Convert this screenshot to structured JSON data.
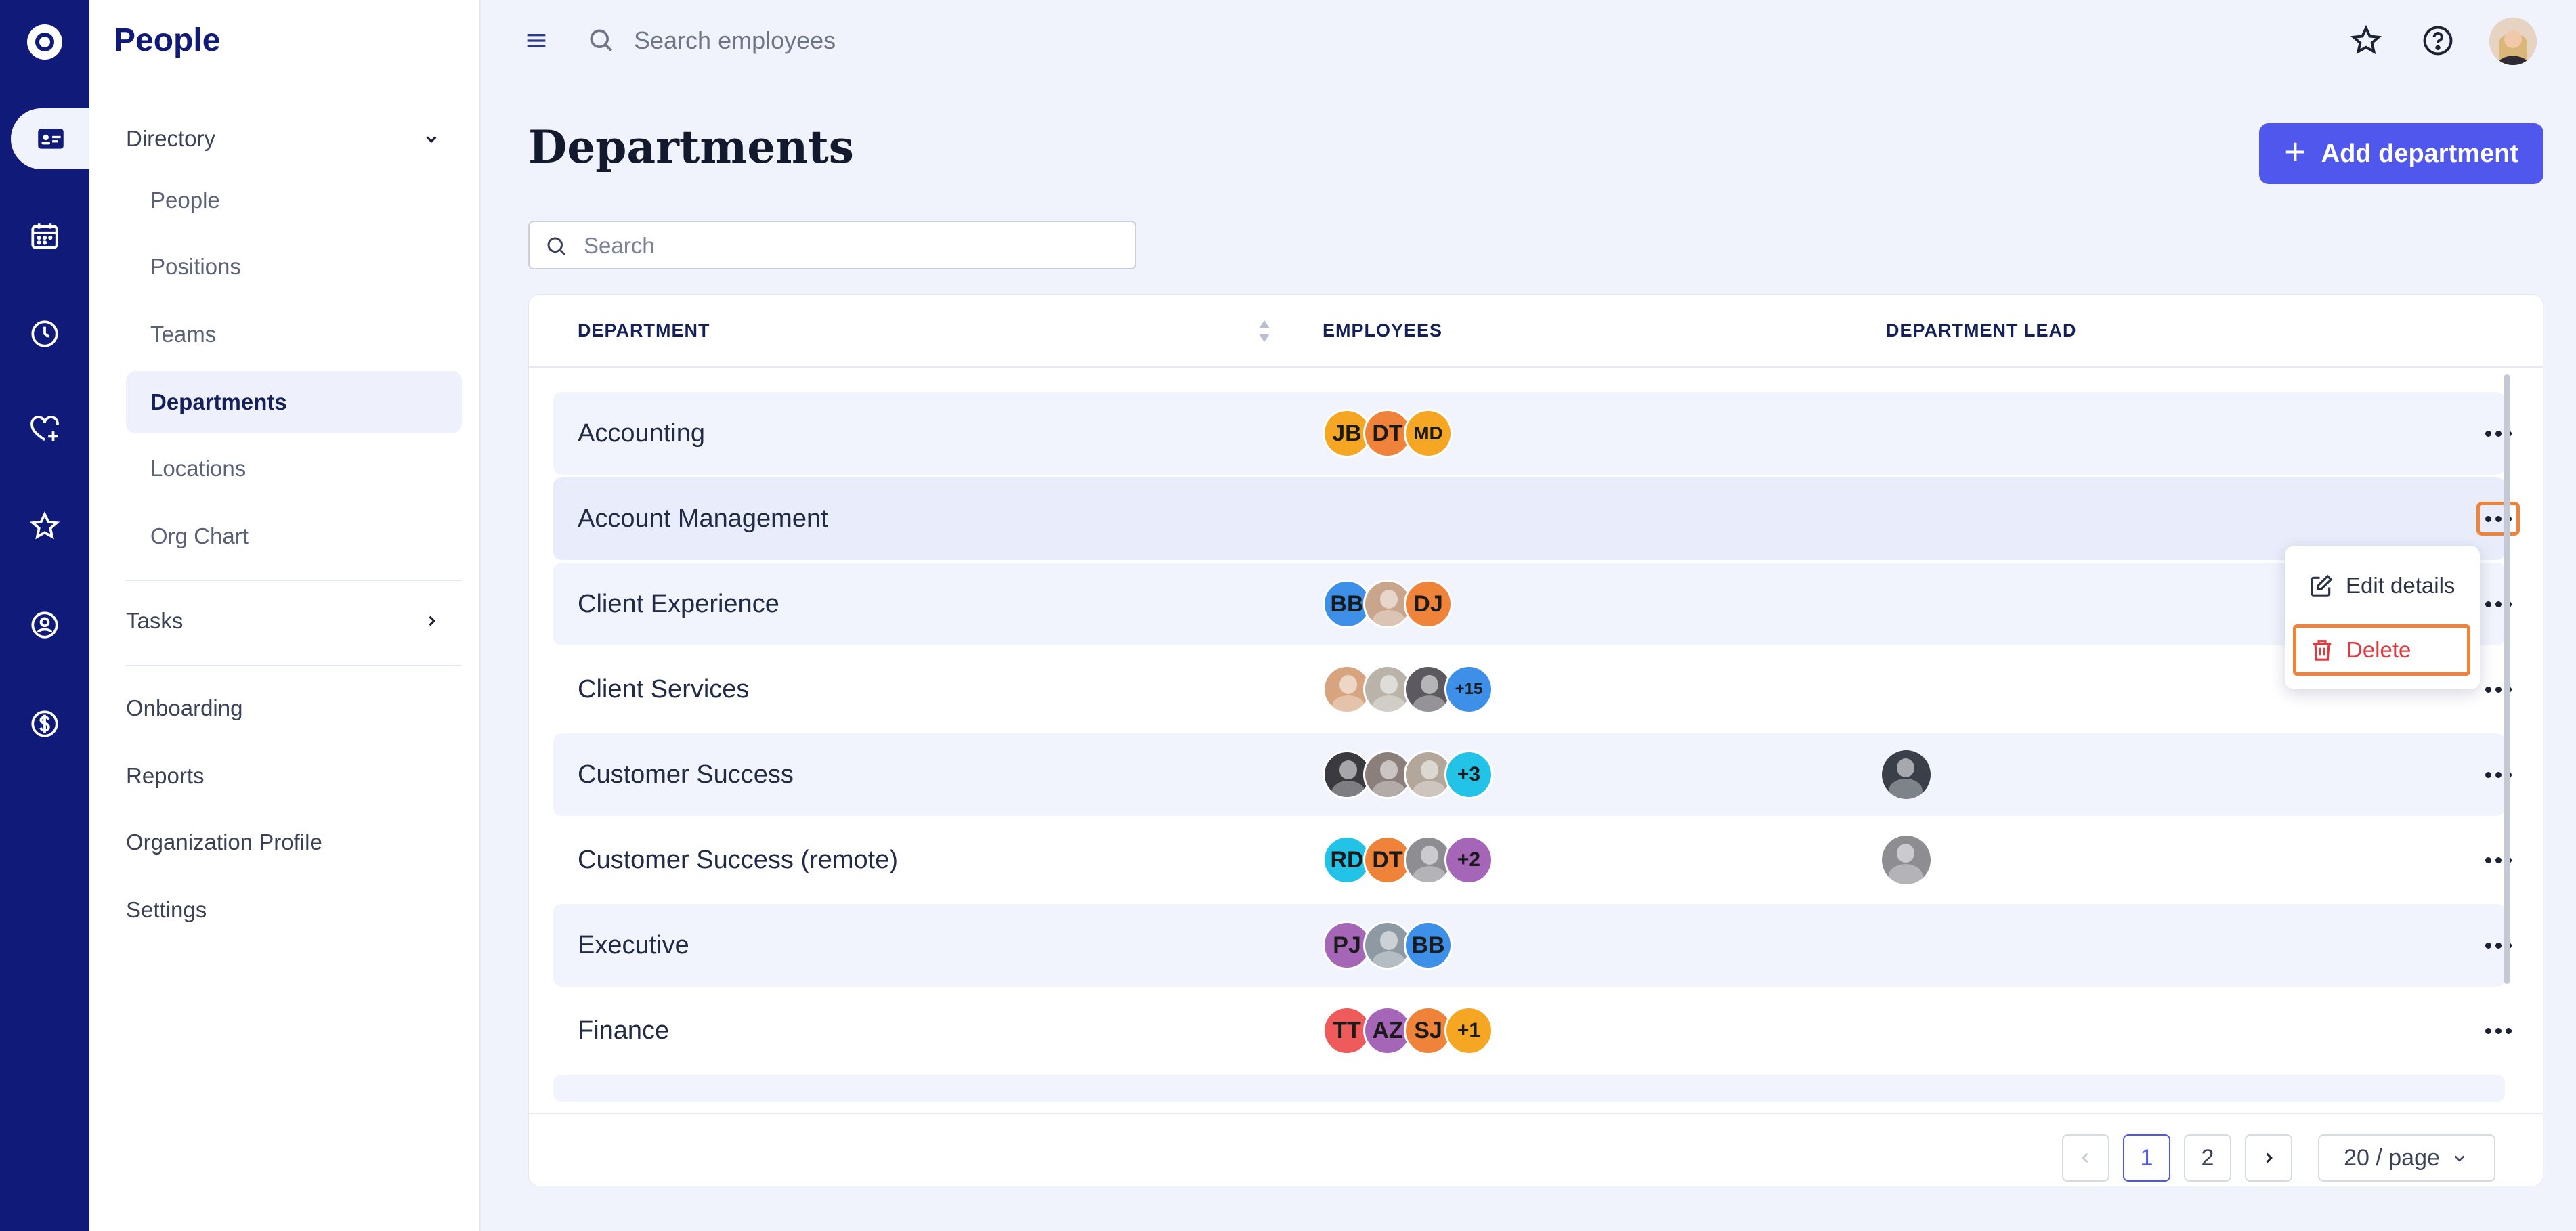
{
  "app": {
    "title": "People"
  },
  "rail": {
    "items": [
      "directory-icon",
      "calendar-icon",
      "clock-icon",
      "heart-plus-icon",
      "star-icon",
      "person-search-icon",
      "dollar-icon"
    ],
    "active": "directory-icon"
  },
  "sidebar": {
    "groups": {
      "directory": {
        "label": "Directory",
        "expanded": true
      },
      "tasks": {
        "label": "Tasks",
        "expanded": false
      }
    },
    "directory_items": [
      {
        "label": "People"
      },
      {
        "label": "Positions"
      },
      {
        "label": "Teams"
      },
      {
        "label": "Departments",
        "active": true
      },
      {
        "label": "Locations"
      },
      {
        "label": "Org Chart"
      }
    ],
    "links": [
      {
        "label": "Onboarding"
      },
      {
        "label": "Reports"
      },
      {
        "label": "Organization Profile"
      },
      {
        "label": "Settings"
      }
    ]
  },
  "topbar": {
    "search_placeholder": "Search employees",
    "icons": [
      "menu-icon",
      "search-icon",
      "star-icon",
      "help-icon",
      "avatar"
    ]
  },
  "page": {
    "title": "Departments",
    "add_button": "Add department",
    "search_placeholder": "Search"
  },
  "table": {
    "headers": {
      "department": "DEPARTMENT",
      "employees": "EMPLOYEES",
      "lead": "DEPARTMENT LEAD"
    },
    "rows": [
      {
        "name": "Accounting",
        "employees": [
          {
            "initials": "JB",
            "color": "#f5a623"
          },
          {
            "initials": "DT",
            "color": "#f0833a"
          },
          {
            "initials": "MD",
            "color": "#f5a623",
            "small": true
          }
        ],
        "lead": false
      },
      {
        "name": "Account Management",
        "employees": [],
        "lead": false,
        "hover": true,
        "menu_open": true
      },
      {
        "name": "Client Experience",
        "employees": [
          {
            "initials": "BB",
            "color": "#3d8fe8"
          },
          {
            "initials": "",
            "color": "#c9a58c",
            "photo": true
          },
          {
            "initials": "DJ",
            "color": "#f0833a"
          }
        ],
        "lead": false
      },
      {
        "name": "Client Services",
        "employees": [
          {
            "initials": "",
            "color": "#d8a47f",
            "photo": true
          },
          {
            "initials": "",
            "color": "#b9b3aa",
            "photo": true
          },
          {
            "initials": "",
            "color": "#5c5a60",
            "photo": true
          },
          {
            "initials": "+15",
            "color": "#3d8fe8",
            "tiny": true
          }
        ],
        "lead": false
      },
      {
        "name": "Customer Success",
        "employees": [
          {
            "initials": "",
            "color": "#3a3a40",
            "photo": true
          },
          {
            "initials": "",
            "color": "#8a7f7a",
            "photo": true
          },
          {
            "initials": "",
            "color": "#b3a79b",
            "photo": true
          },
          {
            "initials": "+3",
            "color": "#22c3e6",
            "more": true
          }
        ],
        "lead": true,
        "lead_color": "#3a3f4a"
      },
      {
        "name": "Customer Success (remote)",
        "employees": [
          {
            "initials": "RD",
            "color": "#22c3e6"
          },
          {
            "initials": "DT",
            "color": "#f0833a"
          },
          {
            "initials": "",
            "color": "#8d8d92",
            "photo": true
          },
          {
            "initials": "+2",
            "color": "#a666b8",
            "more": true
          }
        ],
        "lead": true,
        "lead_color": "#8d8d92"
      },
      {
        "name": "Executive",
        "employees": [
          {
            "initials": "PJ",
            "color": "#a666b8"
          },
          {
            "initials": "",
            "color": "#8d9aa3",
            "photo": true
          },
          {
            "initials": "BB",
            "color": "#3d8fe8"
          }
        ],
        "lead": false
      },
      {
        "name": "Finance",
        "employees": [
          {
            "initials": "TT",
            "color": "#ef5b5b"
          },
          {
            "initials": "AZ",
            "color": "#a666b8"
          },
          {
            "initials": "SJ",
            "color": "#f0833a"
          },
          {
            "initials": "+1",
            "color": "#f5a623",
            "more": true
          }
        ],
        "lead": false
      }
    ]
  },
  "context_menu": {
    "items": [
      {
        "label": "Edit details",
        "icon": "edit-icon"
      },
      {
        "label": "Delete",
        "icon": "trash-icon",
        "danger": true
      }
    ]
  },
  "pagination": {
    "pages": [
      "1",
      "2"
    ],
    "current": "1",
    "page_size": "20 / page"
  },
  "colors": {
    "rail": "#101a78",
    "accent": "#5057ec",
    "danger": "#e0393e",
    "focus": "#f0833a"
  }
}
